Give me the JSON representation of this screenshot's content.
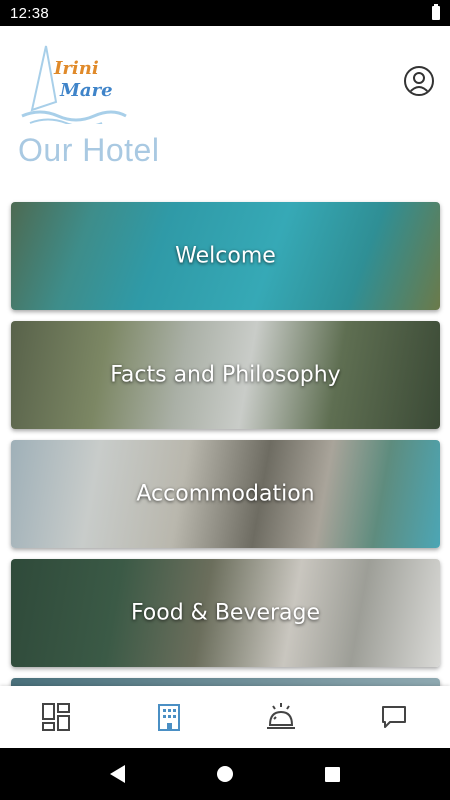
{
  "status": {
    "time": "12:38"
  },
  "header": {
    "logo": {
      "line1": "Irini",
      "line2": "Mare"
    },
    "title": "Our Hotel"
  },
  "cards": [
    {
      "label": "Welcome"
    },
    {
      "label": "Facts and Philosophy"
    },
    {
      "label": "Accommodation"
    },
    {
      "label": "Food & Beverage"
    }
  ],
  "bottom_nav": {
    "items": [
      {
        "icon": "dashboard-grid-icon",
        "active": false
      },
      {
        "icon": "hotel-building-icon",
        "active": true
      },
      {
        "icon": "reception-bell-icon",
        "active": false
      },
      {
        "icon": "chat-bubble-icon",
        "active": false
      }
    ],
    "active_color": "#4a8fc4",
    "inactive_color": "#444444"
  },
  "colors": {
    "title": "#a9c9e2",
    "logo_orange": "#e08a2a",
    "logo_blue": "#3f84c9"
  }
}
